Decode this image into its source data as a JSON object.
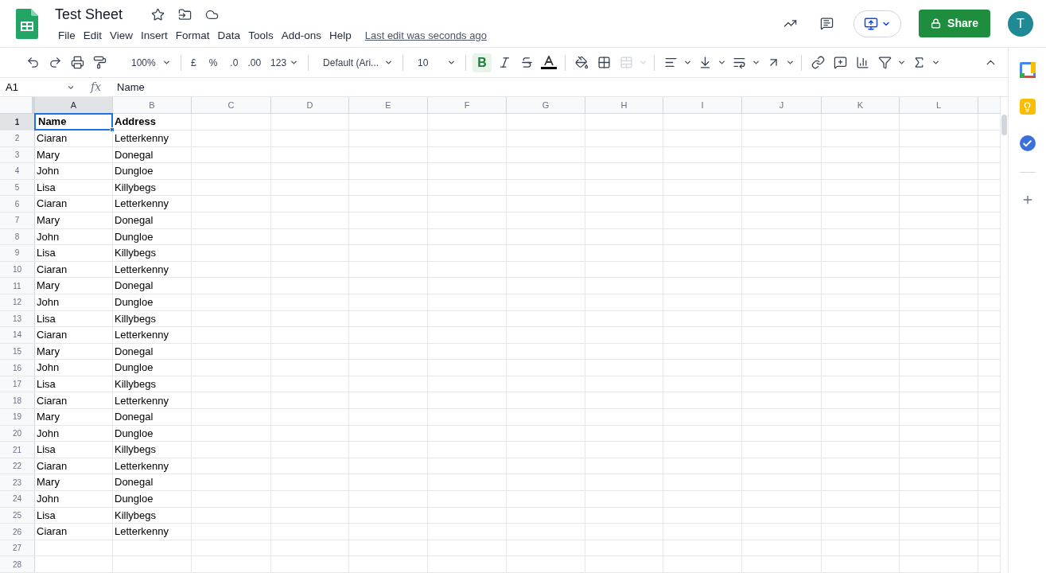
{
  "title": "Test Sheet",
  "menus": [
    "File",
    "Edit",
    "View",
    "Insert",
    "Format",
    "Data",
    "Tools",
    "Add-ons",
    "Help"
  ],
  "last_edit": "Last edit was seconds ago",
  "share": "Share",
  "avatar": "T",
  "toolbar": {
    "zoom": "100%",
    "currency": "£",
    "percent": "%",
    "decrease_decimal": ".0",
    "increase_decimal": ".00",
    "number_format": "123",
    "font": "Default (Ari...",
    "font_size": "10",
    "bold": "B",
    "bold_selected": true
  },
  "formula_bar": {
    "name_box": "A1",
    "fx": "fx",
    "value": "Name"
  },
  "columns": [
    {
      "label": "A",
      "selected": true
    },
    {
      "label": "B",
      "selected": false
    },
    {
      "label": "C",
      "selected": false
    },
    {
      "label": "D",
      "selected": false
    },
    {
      "label": "E",
      "selected": false
    },
    {
      "label": "F",
      "selected": false
    },
    {
      "label": "G",
      "selected": false
    },
    {
      "label": "H",
      "selected": false
    },
    {
      "label": "I",
      "selected": false
    },
    {
      "label": "J",
      "selected": false
    },
    {
      "label": "K",
      "selected": false
    },
    {
      "label": "L",
      "selected": false
    }
  ],
  "rows": [
    {
      "number": "1",
      "selected": true,
      "bold": true,
      "cells": [
        {
          "text": "Name",
          "selected": true
        },
        {
          "text": "Address",
          "selected": false
        }
      ]
    },
    {
      "number": "2",
      "selected": false,
      "bold": false,
      "cells": [
        {
          "text": "Ciaran",
          "selected": false
        },
        {
          "text": "Letterkenny",
          "selected": false
        }
      ]
    },
    {
      "number": "3",
      "selected": false,
      "bold": false,
      "cells": [
        {
          "text": "Mary",
          "selected": false
        },
        {
          "text": "Donegal",
          "selected": false
        }
      ]
    },
    {
      "number": "4",
      "selected": false,
      "bold": false,
      "cells": [
        {
          "text": "John",
          "selected": false
        },
        {
          "text": "Dungloe",
          "selected": false
        }
      ]
    },
    {
      "number": "5",
      "selected": false,
      "bold": false,
      "cells": [
        {
          "text": "Lisa",
          "selected": false
        },
        {
          "text": "Killybegs",
          "selected": false
        }
      ]
    },
    {
      "number": "6",
      "selected": false,
      "bold": false,
      "cells": [
        {
          "text": "Ciaran",
          "selected": false
        },
        {
          "text": "Letterkenny",
          "selected": false
        }
      ]
    },
    {
      "number": "7",
      "selected": false,
      "bold": false,
      "cells": [
        {
          "text": "Mary",
          "selected": false
        },
        {
          "text": "Donegal",
          "selected": false
        }
      ]
    },
    {
      "number": "8",
      "selected": false,
      "bold": false,
      "cells": [
        {
          "text": "John",
          "selected": false
        },
        {
          "text": "Dungloe",
          "selected": false
        }
      ]
    },
    {
      "number": "9",
      "selected": false,
      "bold": false,
      "cells": [
        {
          "text": "Lisa",
          "selected": false
        },
        {
          "text": "Killybegs",
          "selected": false
        }
      ]
    },
    {
      "number": "10",
      "selected": false,
      "bold": false,
      "cells": [
        {
          "text": "Ciaran",
          "selected": false
        },
        {
          "text": "Letterkenny",
          "selected": false
        }
      ]
    },
    {
      "number": "11",
      "selected": false,
      "bold": false,
      "cells": [
        {
          "text": "Mary",
          "selected": false
        },
        {
          "text": "Donegal",
          "selected": false
        }
      ]
    },
    {
      "number": "12",
      "selected": false,
      "bold": false,
      "cells": [
        {
          "text": "John",
          "selected": false
        },
        {
          "text": "Dungloe",
          "selected": false
        }
      ]
    },
    {
      "number": "13",
      "selected": false,
      "bold": false,
      "cells": [
        {
          "text": "Lisa",
          "selected": false
        },
        {
          "text": "Killybegs",
          "selected": false
        }
      ]
    },
    {
      "number": "14",
      "selected": false,
      "bold": false,
      "cells": [
        {
          "text": "Ciaran",
          "selected": false
        },
        {
          "text": "Letterkenny",
          "selected": false
        }
      ]
    },
    {
      "number": "15",
      "selected": false,
      "bold": false,
      "cells": [
        {
          "text": "Mary",
          "selected": false
        },
        {
          "text": "Donegal",
          "selected": false
        }
      ]
    },
    {
      "number": "16",
      "selected": false,
      "bold": false,
      "cells": [
        {
          "text": "John",
          "selected": false
        },
        {
          "text": "Dungloe",
          "selected": false
        }
      ]
    },
    {
      "number": "17",
      "selected": false,
      "bold": false,
      "cells": [
        {
          "text": "Lisa",
          "selected": false
        },
        {
          "text": "Killybegs",
          "selected": false
        }
      ]
    },
    {
      "number": "18",
      "selected": false,
      "bold": false,
      "cells": [
        {
          "text": "Ciaran",
          "selected": false
        },
        {
          "text": "Letterkenny",
          "selected": false
        }
      ]
    },
    {
      "number": "19",
      "selected": false,
      "bold": false,
      "cells": [
        {
          "text": "Mary",
          "selected": false
        },
        {
          "text": "Donegal",
          "selected": false
        }
      ]
    },
    {
      "number": "20",
      "selected": false,
      "bold": false,
      "cells": [
        {
          "text": "John",
          "selected": false
        },
        {
          "text": "Dungloe",
          "selected": false
        }
      ]
    },
    {
      "number": "21",
      "selected": false,
      "bold": false,
      "cells": [
        {
          "text": "Lisa",
          "selected": false
        },
        {
          "text": "Killybegs",
          "selected": false
        }
      ]
    },
    {
      "number": "22",
      "selected": false,
      "bold": false,
      "cells": [
        {
          "text": "Ciaran",
          "selected": false
        },
        {
          "text": "Letterkenny",
          "selected": false
        }
      ]
    },
    {
      "number": "23",
      "selected": false,
      "bold": false,
      "cells": [
        {
          "text": "Mary",
          "selected": false
        },
        {
          "text": "Donegal",
          "selected": false
        }
      ]
    },
    {
      "number": "24",
      "selected": false,
      "bold": false,
      "cells": [
        {
          "text": "John",
          "selected": false
        },
        {
          "text": "Dungloe",
          "selected": false
        }
      ]
    },
    {
      "number": "25",
      "selected": false,
      "bold": false,
      "cells": [
        {
          "text": "Lisa",
          "selected": false
        },
        {
          "text": "Killybegs",
          "selected": false
        }
      ]
    },
    {
      "number": "26",
      "selected": false,
      "bold": false,
      "cells": [
        {
          "text": "Ciaran",
          "selected": false
        },
        {
          "text": "Letterkenny",
          "selected": false
        }
      ]
    },
    {
      "number": "27",
      "selected": false,
      "bold": false,
      "cells": []
    },
    {
      "number": "28",
      "selected": false,
      "bold": false,
      "cells": []
    }
  ]
}
